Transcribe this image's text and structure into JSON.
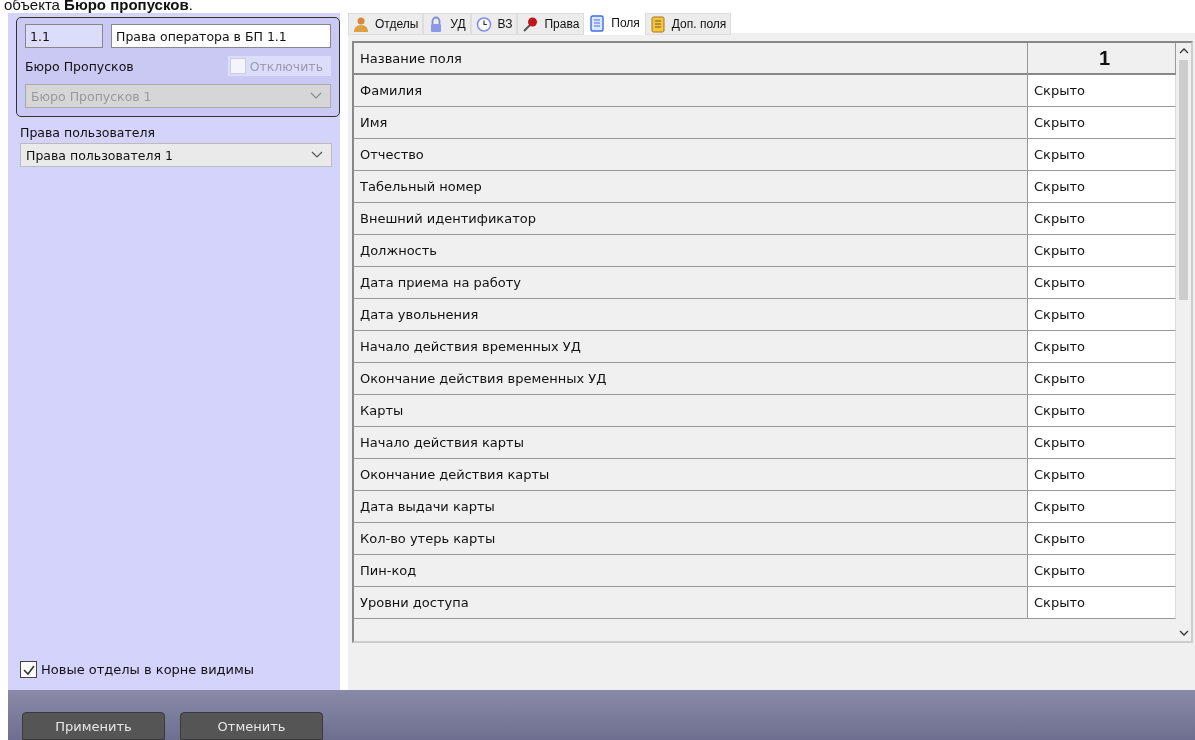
{
  "caption": "объекта **Бюро пропусков**.",
  "left": {
    "id_field": "1.1",
    "name_field": "Права оператора в БП 1.1",
    "bureau_label": "Бюро Пропусков",
    "disable_checkbox": {
      "label": "Отключить",
      "checked": false,
      "disabled": true
    },
    "bureau_select": {
      "value": "Бюро Пропусков 1",
      "disabled": true
    },
    "rights_label": "Права пользователя",
    "rights_select": {
      "value": "Права пользователя 1"
    },
    "new_departments_checkbox": {
      "label": "Новые отделы в корне видимы",
      "checked": true
    }
  },
  "tabs": [
    {
      "label": "Отделы",
      "selected": false
    },
    {
      "label": "УД",
      "selected": false
    },
    {
      "label": "ВЗ",
      "selected": false
    },
    {
      "label": "Права",
      "selected": false
    },
    {
      "label": "Поля",
      "selected": true
    },
    {
      "label": "Доп. поля",
      "selected": false
    }
  ],
  "table": {
    "columns": [
      "Название поля",
      "1"
    ],
    "rows": [
      {
        "name": "Фамилия",
        "value": "Скрыто"
      },
      {
        "name": "Имя",
        "value": "Скрыто"
      },
      {
        "name": "Отчество",
        "value": "Скрыто"
      },
      {
        "name": "Табельный номер",
        "value": "Скрыто"
      },
      {
        "name": "Внешний идентификатор",
        "value": "Скрыто"
      },
      {
        "name": "Должность",
        "value": "Скрыто"
      },
      {
        "name": "Дата приема на работу",
        "value": "Скрыто"
      },
      {
        "name": "Дата увольнения",
        "value": "Скрыто"
      },
      {
        "name": "Начало действия временных УД",
        "value": "Скрыто"
      },
      {
        "name": "Окончание действия временных УД",
        "value": "Скрыто"
      },
      {
        "name": "Карты",
        "value": "Скрыто"
      },
      {
        "name": "Начало действия карты",
        "value": "Скрыто"
      },
      {
        "name": "Окончание действия карты",
        "value": "Скрыто"
      },
      {
        "name": "Дата выдачи карты",
        "value": "Скрыто"
      },
      {
        "name": "Кол-во утерь карты",
        "value": "Скрыто"
      },
      {
        "name": "Пин-код",
        "value": "Скрыто"
      },
      {
        "name": "Уровни доступа",
        "value": "Скрыто"
      }
    ]
  },
  "buttons": [
    "Применить",
    "Отменить"
  ]
}
